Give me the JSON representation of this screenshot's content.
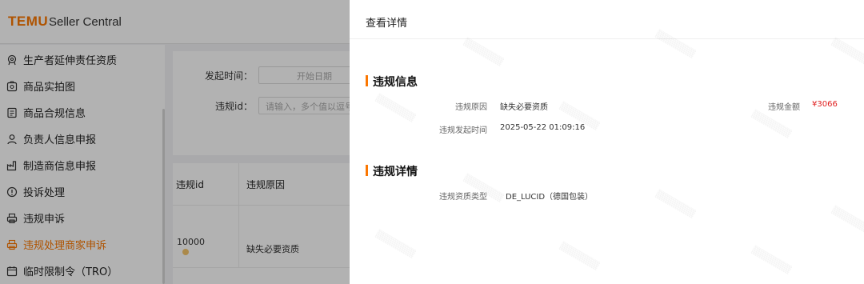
{
  "header": {
    "logo": "TEMU",
    "app_name": "Seller Central"
  },
  "sidebar": {
    "items": [
      {
        "label": "生产者延伸责任资质",
        "icon": "badge-icon"
      },
      {
        "label": "商品实拍图",
        "icon": "photo-icon"
      },
      {
        "label": "商品合规信息",
        "icon": "document-icon"
      },
      {
        "label": "负责人信息申报",
        "icon": "person-icon"
      },
      {
        "label": "制造商信息申报",
        "icon": "factory-icon"
      },
      {
        "label": "投诉处理",
        "icon": "alert-circle-icon"
      },
      {
        "label": "违规申诉",
        "icon": "printer-icon"
      },
      {
        "label": "违规处理商家申诉",
        "icon": "printer-icon",
        "active": true
      },
      {
        "label": "临时限制令（TRO）",
        "icon": "calendar-icon"
      }
    ]
  },
  "filters": {
    "start_time_label": "发起时间：",
    "start_date_placeholder": "开始日期",
    "id_label": "违规id：",
    "id_placeholder": "请输入，多个值以逗号或空"
  },
  "table": {
    "columns": [
      "违规id",
      "违规原因"
    ],
    "rows": [
      {
        "id": "10000",
        "reason": "缺失必要资质"
      }
    ]
  },
  "drawer": {
    "title": "查看详情",
    "section1": {
      "title": "违规信息",
      "reason_label": "违规原因",
      "reason_value": "缺失必要资质",
      "amount_label": "违规金额",
      "amount_value": "¥3066",
      "time_label": "违规发起时间",
      "time_value": "2025-05-22 01:09:16"
    },
    "section2": {
      "title": "违规详情",
      "type_label": "违规资质类型",
      "type_value": "DE_LUCID（德国包装）"
    }
  },
  "colors": {
    "brand": "#fb7701",
    "amount": "#e02020"
  }
}
